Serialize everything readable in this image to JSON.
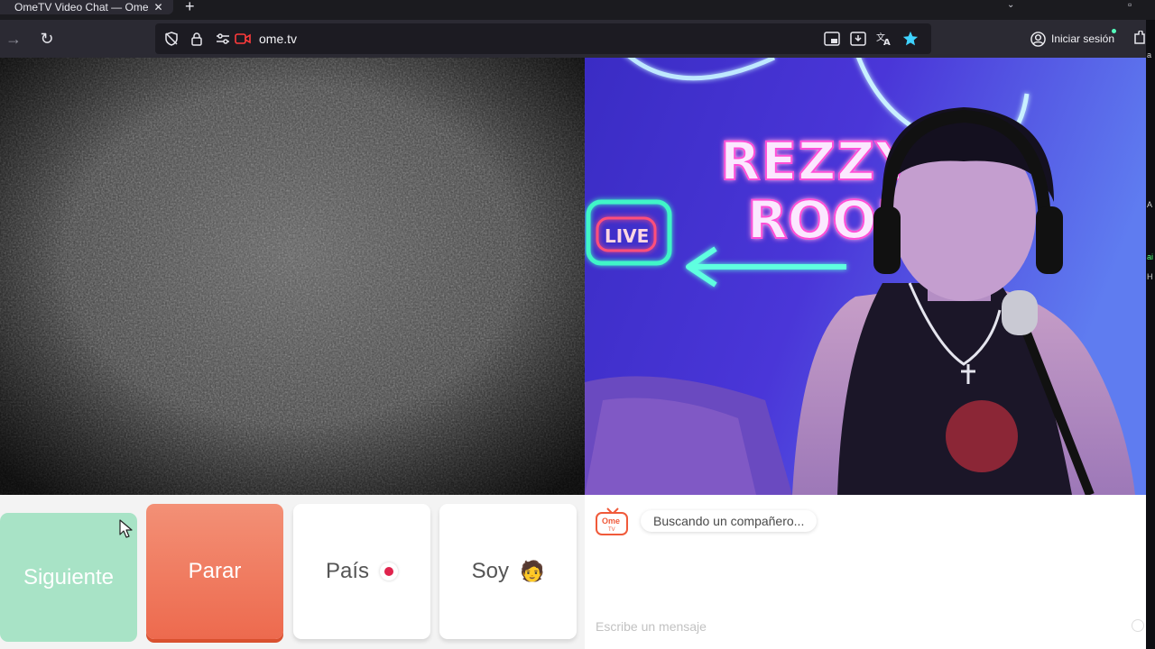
{
  "browser": {
    "tab_title": "OmeTV Video Chat — Ome",
    "tab_close": "✕",
    "new_tab": "+",
    "url": "ome.tv",
    "signin_label": "Iniciar sesión",
    "colors": {
      "chrome": "#2b2a33",
      "urlbar": "#1c1b22",
      "star": "#3fd3ff"
    }
  },
  "icons": {
    "forward": "→",
    "reload": "↻"
  },
  "local_video": {
    "neon_sign_line1": "REZZY'S",
    "neon_sign_line2": "ROOM",
    "neon_badge": "LIVE"
  },
  "controls": {
    "next_label": "Siguiente",
    "stop_label": "Parar",
    "country_label": "País",
    "gender_label": "Soy",
    "gender_emoji": "🧑",
    "colors": {
      "next": "#a8e3c6",
      "stop": "#ed6a4e",
      "country_dot": "#e0244d"
    }
  },
  "chat": {
    "logo_text": "Ome",
    "logo_sub": "TV",
    "status_message": "Buscando un compañero...",
    "input_placeholder": "Escribe un mensaje"
  }
}
